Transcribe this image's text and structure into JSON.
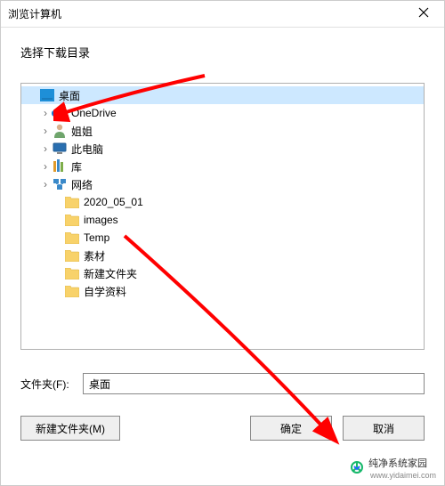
{
  "titlebar": {
    "title": "浏览计算机"
  },
  "subtitle": "选择下载目录",
  "tree": {
    "items": [
      {
        "label": "桌面",
        "icon": "desktop",
        "selected": true,
        "expandable": false,
        "indent": 0
      },
      {
        "label": "OneDrive",
        "icon": "onedrive",
        "selected": false,
        "expandable": true,
        "indent": 1
      },
      {
        "label": "姐姐",
        "icon": "user",
        "selected": false,
        "expandable": true,
        "indent": 1
      },
      {
        "label": "此电脑",
        "icon": "thispc",
        "selected": false,
        "expandable": true,
        "indent": 1
      },
      {
        "label": "库",
        "icon": "library",
        "selected": false,
        "expandable": true,
        "indent": 1
      },
      {
        "label": "网络",
        "icon": "network",
        "selected": false,
        "expandable": true,
        "indent": 1
      },
      {
        "label": "2020_05_01",
        "icon": "folder",
        "selected": false,
        "expandable": false,
        "indent": 2
      },
      {
        "label": "images",
        "icon": "folder",
        "selected": false,
        "expandable": false,
        "indent": 2
      },
      {
        "label": "Temp",
        "icon": "folder",
        "selected": false,
        "expandable": false,
        "indent": 2
      },
      {
        "label": "素材",
        "icon": "folder",
        "selected": false,
        "expandable": false,
        "indent": 2
      },
      {
        "label": "新建文件夹",
        "icon": "folder",
        "selected": false,
        "expandable": false,
        "indent": 2
      },
      {
        "label": "自学资料",
        "icon": "folder",
        "selected": false,
        "expandable": false,
        "indent": 2
      }
    ]
  },
  "folder_field": {
    "label": "文件夹(F):",
    "value": "桌面"
  },
  "buttons": {
    "new_folder": "新建文件夹(M)",
    "ok": "确定",
    "cancel": "取消"
  },
  "watermark": {
    "brand": "纯净系统家园",
    "url": "www.yidaimei.com"
  },
  "colors": {
    "selection": "#cde8ff",
    "border": "#b0b0b0",
    "arrow": "#ff0000"
  }
}
